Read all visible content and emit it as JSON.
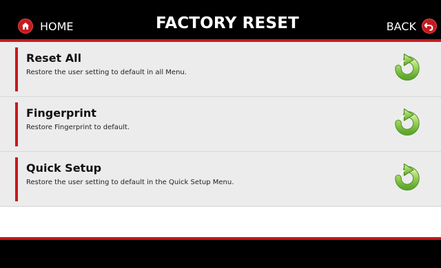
{
  "header": {
    "home_label": "HOME",
    "title": "FACTORY RESET",
    "back_label": "BACK",
    "home_icon": "home-icon",
    "back_icon": "back-arrow-icon",
    "accent_color": "#c51a1f",
    "background_color": "#000000"
  },
  "items": [
    {
      "title": "Reset All",
      "description": "Restore the user setting to default in all Menu.",
      "icon": "reset-icon"
    },
    {
      "title": "Fingerprint",
      "description": "Restore Fingerprint to default.",
      "icon": "reset-icon"
    },
    {
      "title": "Quick Setup",
      "description": "Restore the user setting to default in the Quick Setup Menu.",
      "icon": "reset-icon"
    }
  ],
  "colors": {
    "row_background": "#ececec",
    "icon_green": "#80c542"
  }
}
